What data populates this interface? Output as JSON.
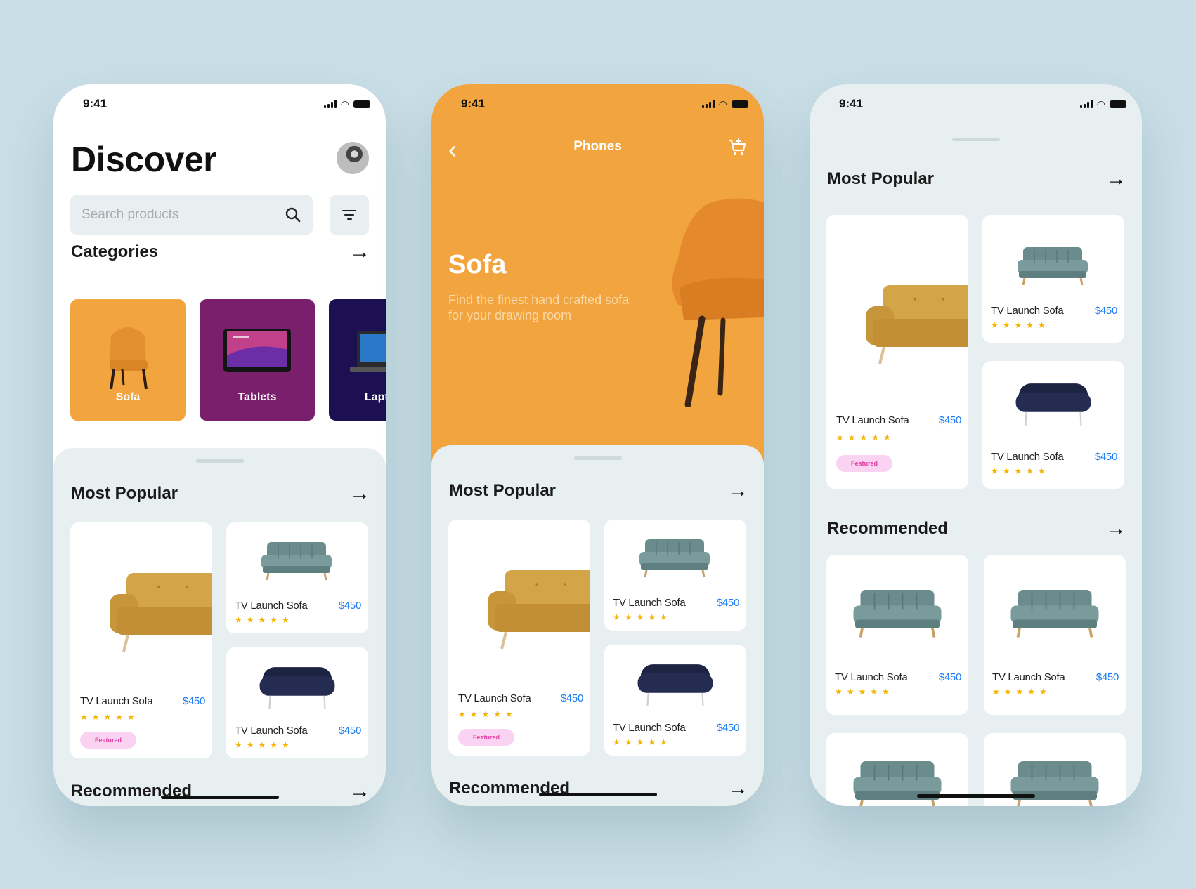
{
  "status": {
    "time": "9:41"
  },
  "product": {
    "name": "TV Launch Sofa",
    "price": "$450",
    "stars": "★★★★★",
    "badge": "Featured"
  },
  "discover": {
    "title": "Discover",
    "search_placeholder": "Search products",
    "categories_title": "Categories",
    "categories": [
      {
        "label": "Sofa",
        "color": "#f2a43f"
      },
      {
        "label": "Tablets",
        "color": "#7a1f6c"
      },
      {
        "label": "Laptops",
        "color": "#1c0f52"
      }
    ]
  },
  "detail": {
    "nav_title": "Phones",
    "hero_title": "Sofa",
    "hero_subtitle": "Find the finest hand crafted sofa for your drawing room"
  },
  "sections": {
    "most_popular": "Most Popular",
    "recommended": "Recommended"
  },
  "colors": {
    "accent_orange": "#f2a43f",
    "price_blue": "#1d7cf2",
    "star": "#f4b400",
    "sheet_bg": "#e8eff0",
    "teal_sofa": "#6a8c8c",
    "navy_sofa": "#1d2343",
    "mustard_sofa": "#d09a3a"
  }
}
